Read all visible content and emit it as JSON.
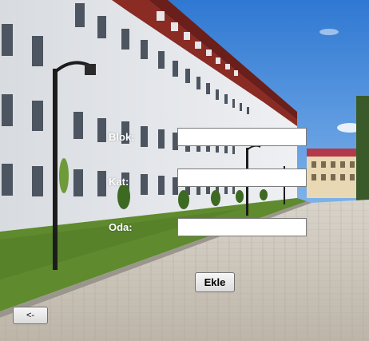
{
  "form": {
    "blok_label": "Blok:",
    "kat_label": "Kat:",
    "oda_label": "Oda:",
    "blok_value": "",
    "kat_value": "",
    "oda_value": ""
  },
  "buttons": {
    "add_label": "Ekle",
    "back_label": "<-"
  },
  "colors": {
    "sky": "#3f86d8",
    "building_wall": "#e6e8ec",
    "roof": "#8a2b24",
    "grass": "#5f8a2e",
    "pavement": "#c9c2b6",
    "label_text": "#ffffff"
  }
}
